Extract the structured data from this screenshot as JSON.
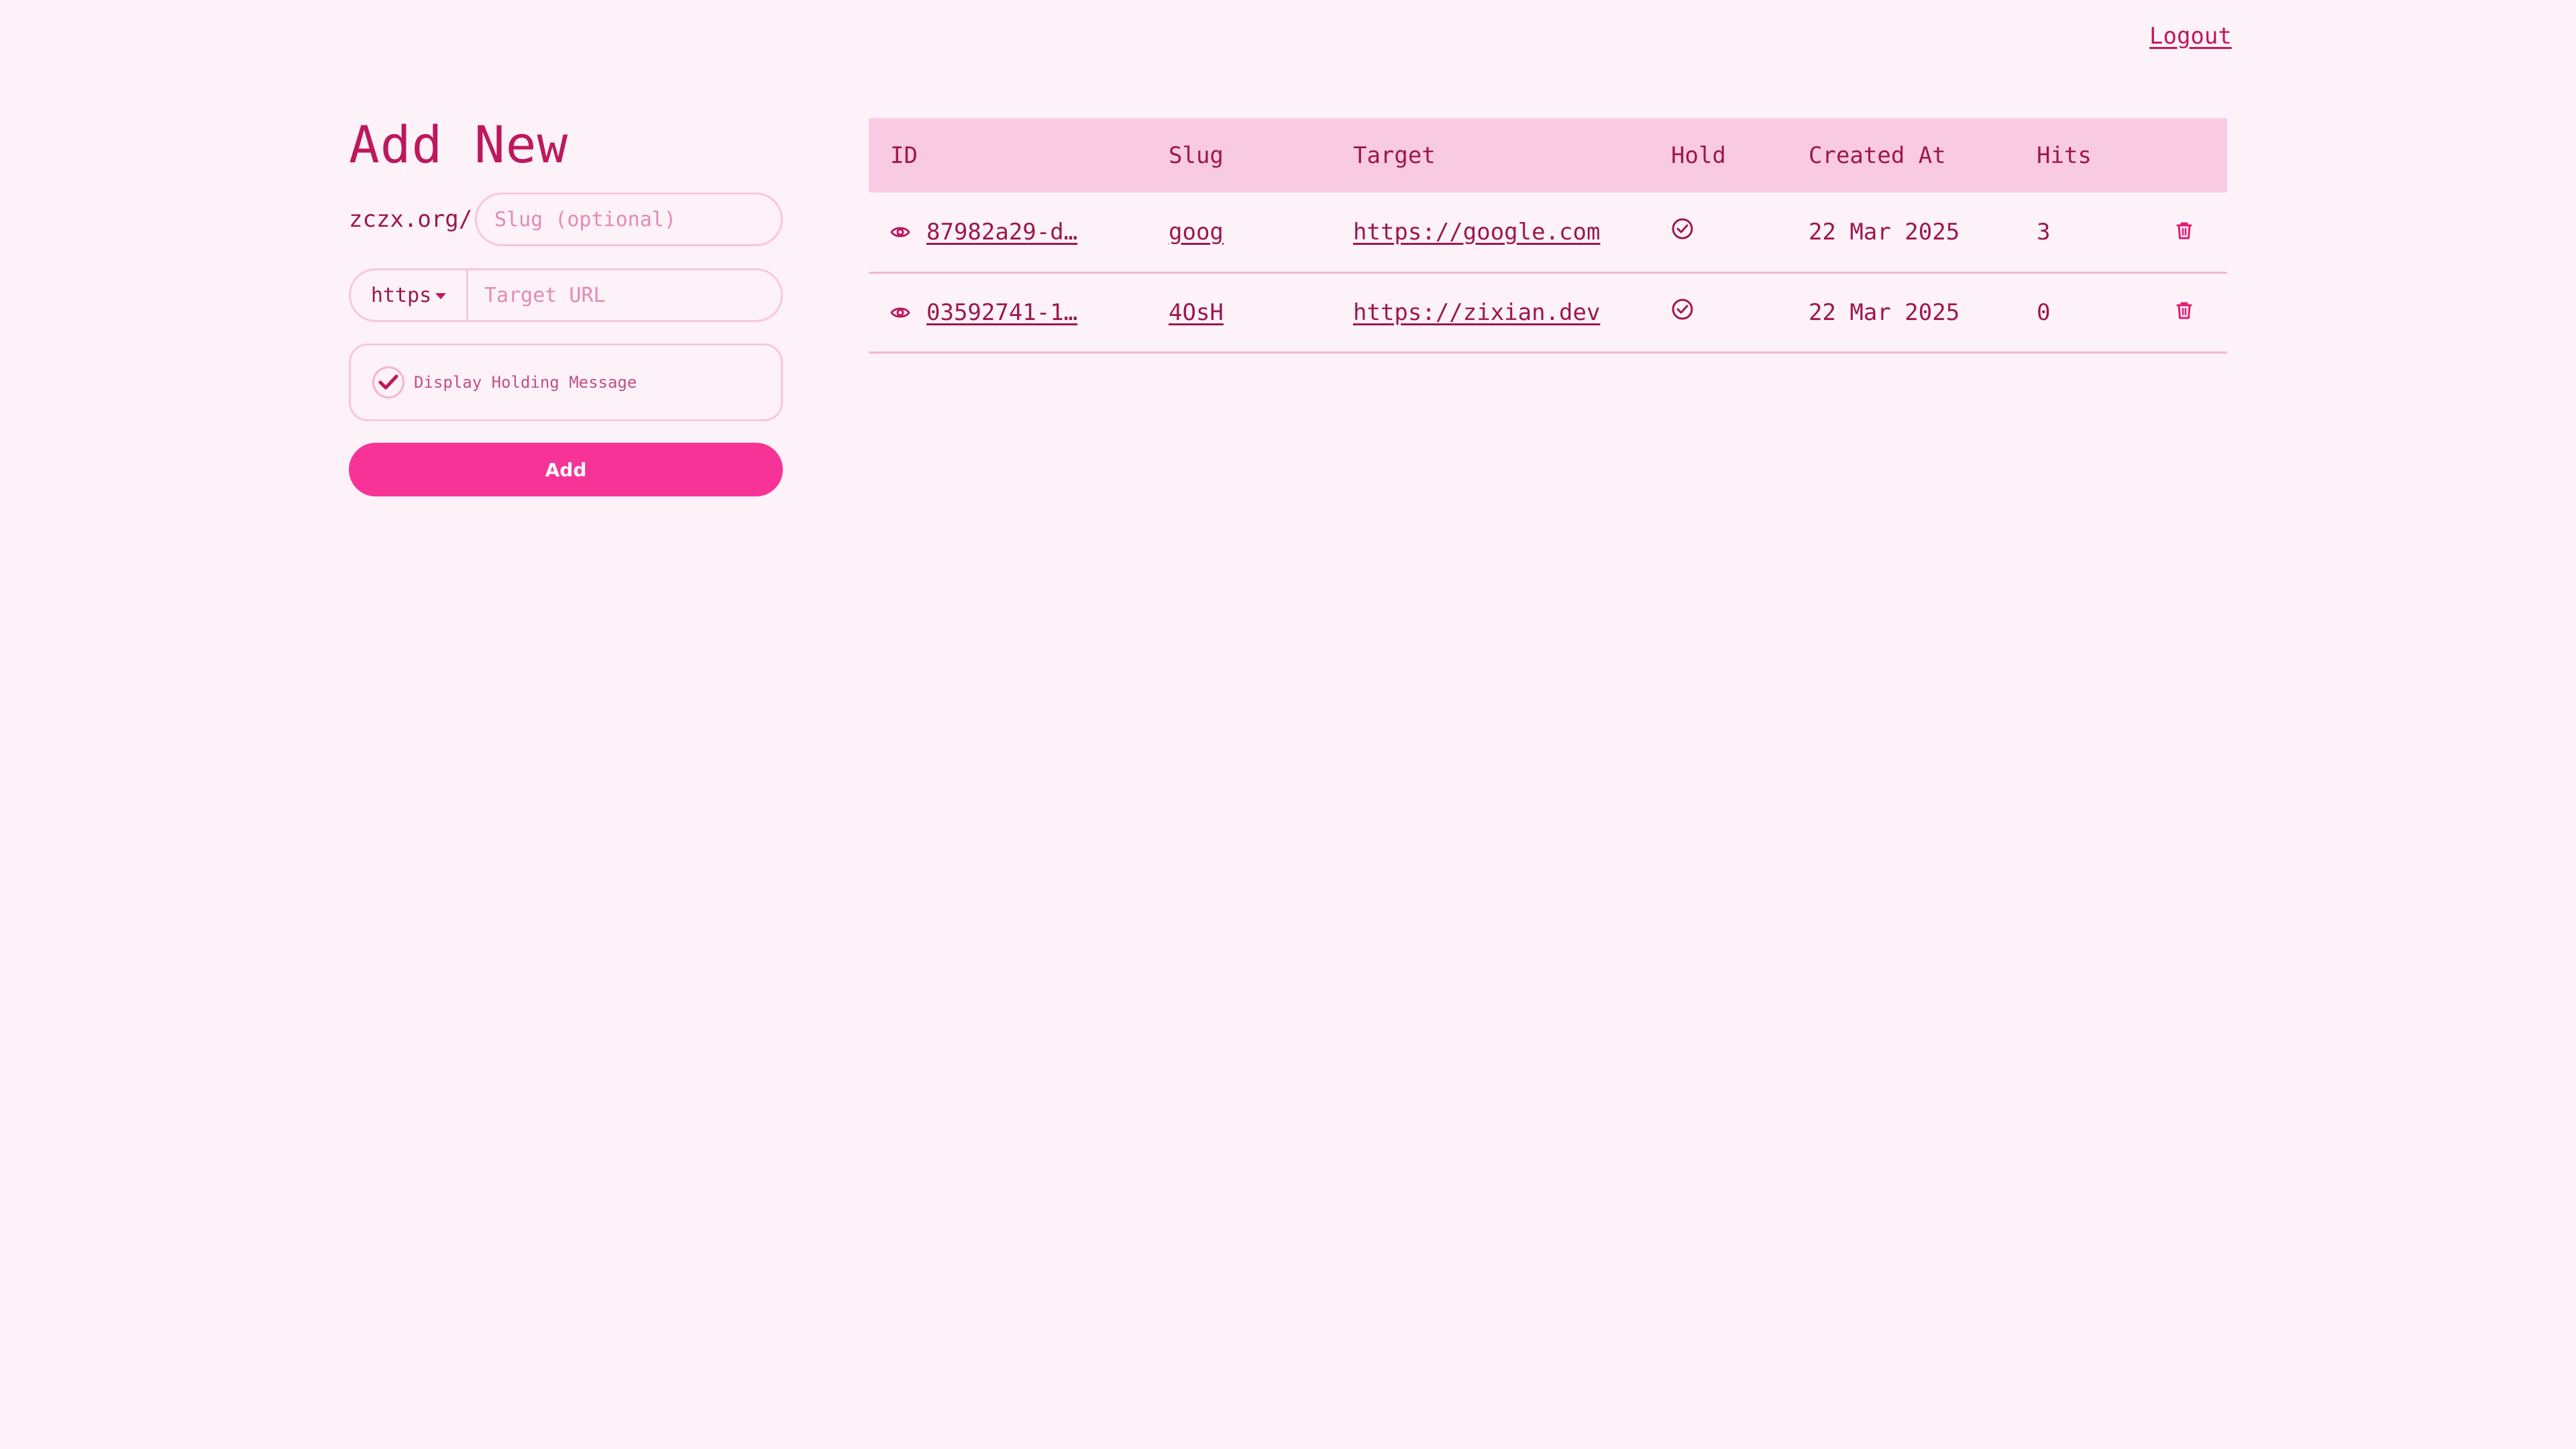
{
  "header": {
    "logout_label": "Logout"
  },
  "form": {
    "title": "Add New",
    "domain_prefix": "zczx.org/",
    "slug_placeholder": "Slug (optional)",
    "protocol": "https",
    "target_placeholder": "Target URL",
    "hold_label": "Display Holding Message",
    "hold_checked": true,
    "add_label": "Add"
  },
  "table": {
    "headers": {
      "id": "ID",
      "slug": "Slug",
      "target": "Target",
      "hold": "Hold",
      "created_at": "Created At",
      "hits": "Hits"
    },
    "rows": [
      {
        "id": "87982a29-d…",
        "slug": "goog",
        "target": "https://google.com",
        "hold": true,
        "created_at": "22 Mar 2025",
        "hits": "3"
      },
      {
        "id": "03592741-1…",
        "slug": "4OsH",
        "target": "https://zixian.dev",
        "hold": true,
        "created_at": "22 Mar 2025",
        "hits": "0"
      }
    ]
  },
  "icons": {
    "view": "eye-icon",
    "hold": "check-circle-icon",
    "delete": "trash-icon",
    "checkbox": "checkmark-icon"
  },
  "colors": {
    "background": "#fdf2f8",
    "accent": "#f73397",
    "text": "#be185d",
    "header_bg": "#f9cbe3",
    "border": "#f9c6dd"
  }
}
